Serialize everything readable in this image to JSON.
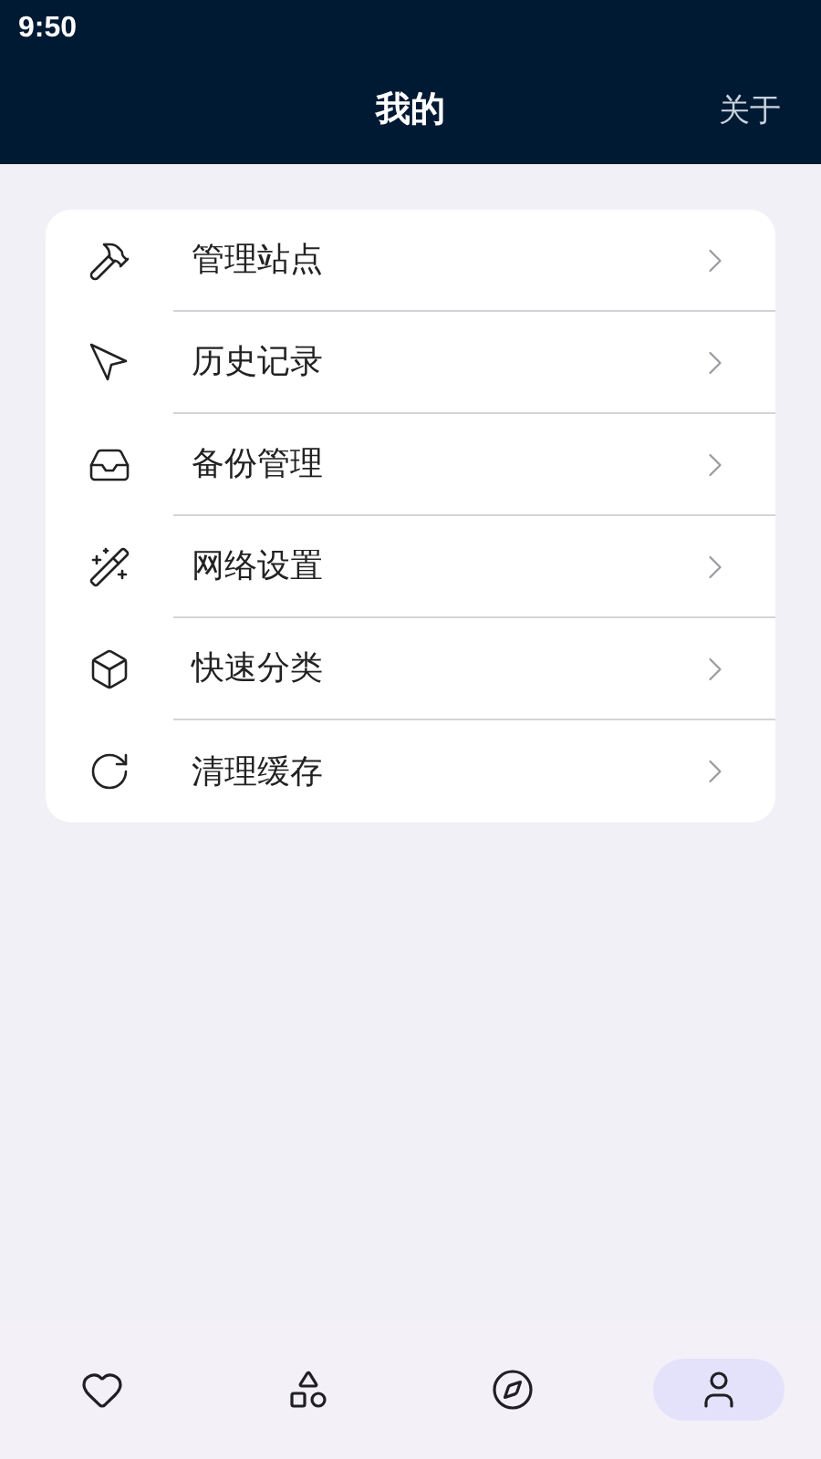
{
  "status_bar": {
    "time": "9:50"
  },
  "header": {
    "title": "我的",
    "action": "关于"
  },
  "menu": [
    {
      "label": "管理站点"
    },
    {
      "label": "历史记录"
    },
    {
      "label": "备份管理"
    },
    {
      "label": "网络设置"
    },
    {
      "label": "快速分类"
    },
    {
      "label": "清理缓存"
    }
  ],
  "tab_bar": [
    {
      "selected": false
    },
    {
      "selected": false
    },
    {
      "selected": false
    },
    {
      "selected": true
    }
  ]
}
